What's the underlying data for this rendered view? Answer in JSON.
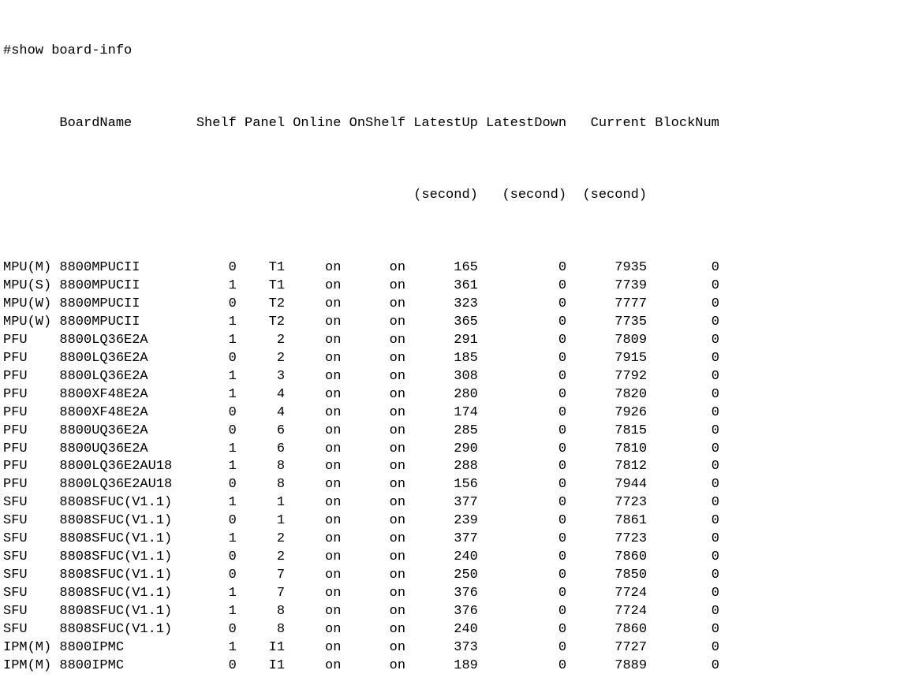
{
  "command": "#show board-info",
  "headers": {
    "type": "",
    "board_name": "BoardName",
    "shelf": "Shelf",
    "panel": "Panel",
    "online": "Online",
    "onshelf": "OnShelf",
    "latest_up": "LatestUp",
    "latest_down": "LatestDown",
    "current": "Current",
    "block_num": "BlockNum",
    "second_label": "(second)"
  },
  "rows": [
    {
      "type": "MPU(M)",
      "board_name": "8800MPUCII",
      "shelf": "0",
      "panel": "T1",
      "online": "on",
      "onshelf": "on",
      "latest_up": "165",
      "latest_down": "0",
      "current": "7935",
      "block_num": "0"
    },
    {
      "type": "MPU(S)",
      "board_name": "8800MPUCII",
      "shelf": "1",
      "panel": "T1",
      "online": "on",
      "onshelf": "on",
      "latest_up": "361",
      "latest_down": "0",
      "current": "7739",
      "block_num": "0"
    },
    {
      "type": "MPU(W)",
      "board_name": "8800MPUCII",
      "shelf": "0",
      "panel": "T2",
      "online": "on",
      "onshelf": "on",
      "latest_up": "323",
      "latest_down": "0",
      "current": "7777",
      "block_num": "0"
    },
    {
      "type": "MPU(W)",
      "board_name": "8800MPUCII",
      "shelf": "1",
      "panel": "T2",
      "online": "on",
      "onshelf": "on",
      "latest_up": "365",
      "latest_down": "0",
      "current": "7735",
      "block_num": "0"
    },
    {
      "type": "PFU",
      "board_name": "8800LQ36E2A",
      "shelf": "1",
      "panel": "2",
      "online": "on",
      "onshelf": "on",
      "latest_up": "291",
      "latest_down": "0",
      "current": "7809",
      "block_num": "0"
    },
    {
      "type": "PFU",
      "board_name": "8800LQ36E2A",
      "shelf": "0",
      "panel": "2",
      "online": "on",
      "onshelf": "on",
      "latest_up": "185",
      "latest_down": "0",
      "current": "7915",
      "block_num": "0"
    },
    {
      "type": "PFU",
      "board_name": "8800LQ36E2A",
      "shelf": "1",
      "panel": "3",
      "online": "on",
      "onshelf": "on",
      "latest_up": "308",
      "latest_down": "0",
      "current": "7792",
      "block_num": "0"
    },
    {
      "type": "PFU",
      "board_name": "8800XF48E2A",
      "shelf": "1",
      "panel": "4",
      "online": "on",
      "onshelf": "on",
      "latest_up": "280",
      "latest_down": "0",
      "current": "7820",
      "block_num": "0"
    },
    {
      "type": "PFU",
      "board_name": "8800XF48E2A",
      "shelf": "0",
      "panel": "4",
      "online": "on",
      "onshelf": "on",
      "latest_up": "174",
      "latest_down": "0",
      "current": "7926",
      "block_num": "0"
    },
    {
      "type": "PFU",
      "board_name": "8800UQ36E2A",
      "shelf": "0",
      "panel": "6",
      "online": "on",
      "onshelf": "on",
      "latest_up": "285",
      "latest_down": "0",
      "current": "7815",
      "block_num": "0"
    },
    {
      "type": "PFU",
      "board_name": "8800UQ36E2A",
      "shelf": "1",
      "panel": "6",
      "online": "on",
      "onshelf": "on",
      "latest_up": "290",
      "latest_down": "0",
      "current": "7810",
      "block_num": "0"
    },
    {
      "type": "PFU",
      "board_name": "8800LQ36E2AU18",
      "shelf": "1",
      "panel": "8",
      "online": "on",
      "onshelf": "on",
      "latest_up": "288",
      "latest_down": "0",
      "current": "7812",
      "block_num": "0"
    },
    {
      "type": "PFU",
      "board_name": "8800LQ36E2AU18",
      "shelf": "0",
      "panel": "8",
      "online": "on",
      "onshelf": "on",
      "latest_up": "156",
      "latest_down": "0",
      "current": "7944",
      "block_num": "0"
    },
    {
      "type": "SFU",
      "board_name": "8808SFUC(V1.1)",
      "shelf": "1",
      "panel": "1",
      "online": "on",
      "onshelf": "on",
      "latest_up": "377",
      "latest_down": "0",
      "current": "7723",
      "block_num": "0"
    },
    {
      "type": "SFU",
      "board_name": "8808SFUC(V1.1)",
      "shelf": "0",
      "panel": "1",
      "online": "on",
      "onshelf": "on",
      "latest_up": "239",
      "latest_down": "0",
      "current": "7861",
      "block_num": "0"
    },
    {
      "type": "SFU",
      "board_name": "8808SFUC(V1.1)",
      "shelf": "1",
      "panel": "2",
      "online": "on",
      "onshelf": "on",
      "latest_up": "377",
      "latest_down": "0",
      "current": "7723",
      "block_num": "0"
    },
    {
      "type": "SFU",
      "board_name": "8808SFUC(V1.1)",
      "shelf": "0",
      "panel": "2",
      "online": "on",
      "onshelf": "on",
      "latest_up": "240",
      "latest_down": "0",
      "current": "7860",
      "block_num": "0"
    },
    {
      "type": "SFU",
      "board_name": "8808SFUC(V1.1)",
      "shelf": "0",
      "panel": "7",
      "online": "on",
      "onshelf": "on",
      "latest_up": "250",
      "latest_down": "0",
      "current": "7850",
      "block_num": "0"
    },
    {
      "type": "SFU",
      "board_name": "8808SFUC(V1.1)",
      "shelf": "1",
      "panel": "7",
      "online": "on",
      "onshelf": "on",
      "latest_up": "376",
      "latest_down": "0",
      "current": "7724",
      "block_num": "0"
    },
    {
      "type": "SFU",
      "board_name": "8808SFUC(V1.1)",
      "shelf": "1",
      "panel": "8",
      "online": "on",
      "onshelf": "on",
      "latest_up": "376",
      "latest_down": "0",
      "current": "7724",
      "block_num": "0"
    },
    {
      "type": "SFU",
      "board_name": "8808SFUC(V1.1)",
      "shelf": "0",
      "panel": "8",
      "online": "on",
      "onshelf": "on",
      "latest_up": "240",
      "latest_down": "0",
      "current": "7860",
      "block_num": "0"
    },
    {
      "type": "IPM(M)",
      "board_name": "8800IPMC",
      "shelf": "1",
      "panel": "I1",
      "online": "on",
      "onshelf": "on",
      "latest_up": "373",
      "latest_down": "0",
      "current": "7727",
      "block_num": "0"
    },
    {
      "type": "IPM(M)",
      "board_name": "8800IPMC",
      "shelf": "0",
      "panel": "I1",
      "online": "on",
      "onshelf": "on",
      "latest_up": "189",
      "latest_down": "0",
      "current": "7889",
      "block_num": "0"
    }
  ]
}
